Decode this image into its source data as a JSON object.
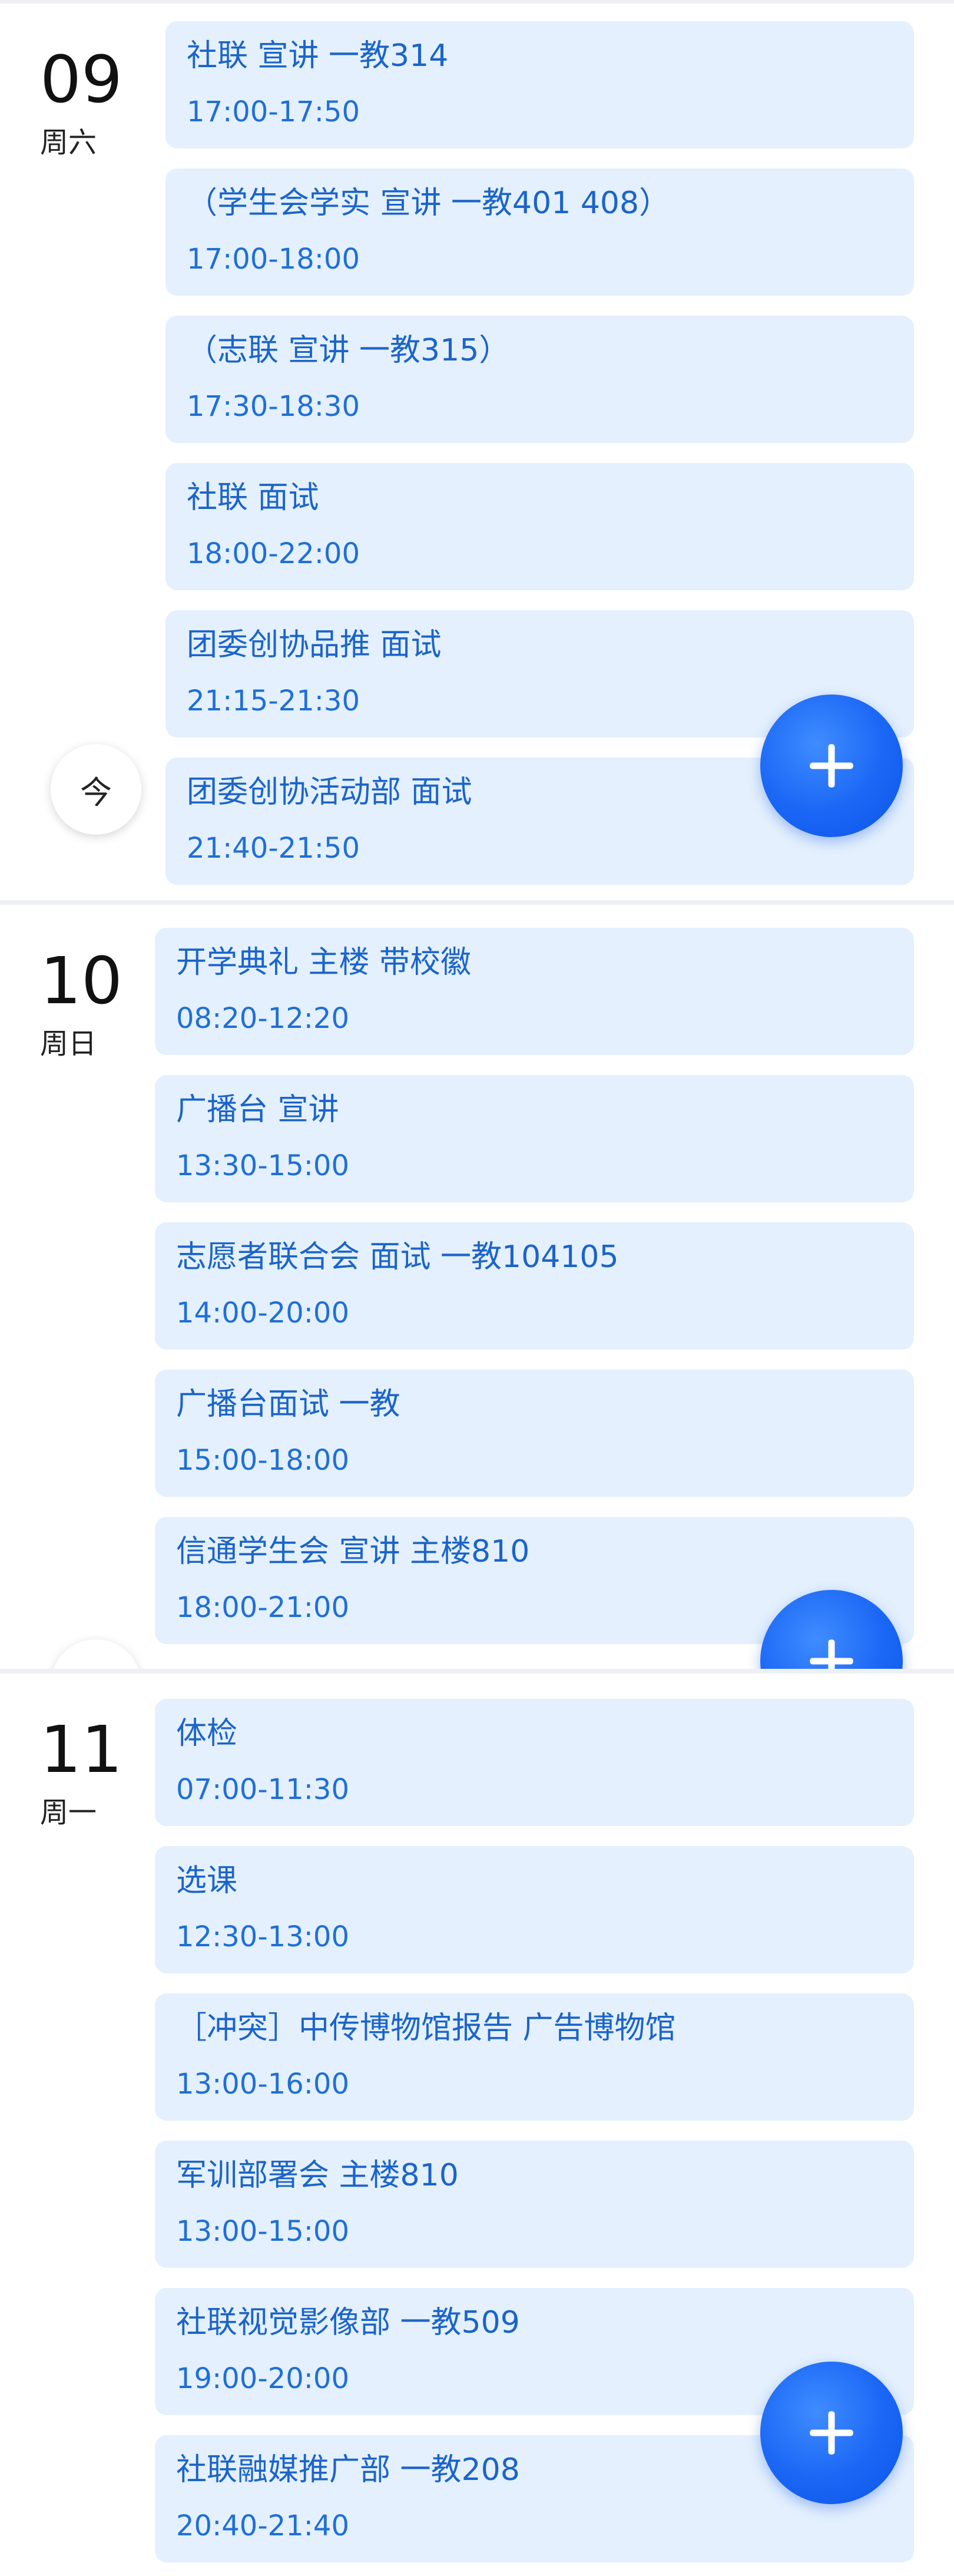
{
  "days": [
    {
      "date": "09",
      "weekday": "周六",
      "events": [
        {
          "title": "社联 宣讲 一教314",
          "time": "17:00-17:50"
        },
        {
          "title": "（学生会学实 宣讲 一教401 408）",
          "time": "17:00-18:00"
        },
        {
          "title": "（志联 宣讲 一教315）",
          "time": "17:30-18:30"
        },
        {
          "title": "社联 面试",
          "time": "18:00-22:00"
        },
        {
          "title": "团委创协品推 面试",
          "time": "21:15-21:30"
        },
        {
          "title": "团委创协活动部 面试",
          "time": "21:40-21:50"
        }
      ]
    },
    {
      "date": "10",
      "weekday": "周日",
      "events": [
        {
          "title": "开学典礼 主楼 带校徽",
          "time": "08:20-12:20"
        },
        {
          "title": "广播台 宣讲",
          "time": "13:30-15:00"
        },
        {
          "title": "志愿者联合会 面试 一教104105",
          "time": "14:00-20:00"
        },
        {
          "title": "广播台面试 一教",
          "time": "15:00-18:00"
        },
        {
          "title": "信通学生会 宣讲 主楼810",
          "time": "18:00-21:00"
        }
      ]
    },
    {
      "date": "11",
      "weekday": "周一",
      "events": [
        {
          "title": "体检",
          "time": "07:00-11:30"
        },
        {
          "title": "选课",
          "time": "12:30-13:00"
        },
        {
          "title": "［冲突］中传博物馆报告 广告博物馆",
          "time": "13:00-16:00"
        },
        {
          "title": "军训部署会 主楼810",
          "time": "13:00-15:00"
        },
        {
          "title": "社联视觉影像部 一教509",
          "time": "19:00-20:00"
        },
        {
          "title": "社联融媒推广部 一教208",
          "time": "20:40-21:40"
        }
      ]
    }
  ],
  "today_button": {
    "label": "今"
  },
  "fab": {
    "icon": "plus-icon"
  },
  "colors": {
    "card_bg": "#e4f0fd",
    "card_text": "#1b64c9",
    "fab_blue": "#1a66f5",
    "divider": "#eef0f3"
  }
}
